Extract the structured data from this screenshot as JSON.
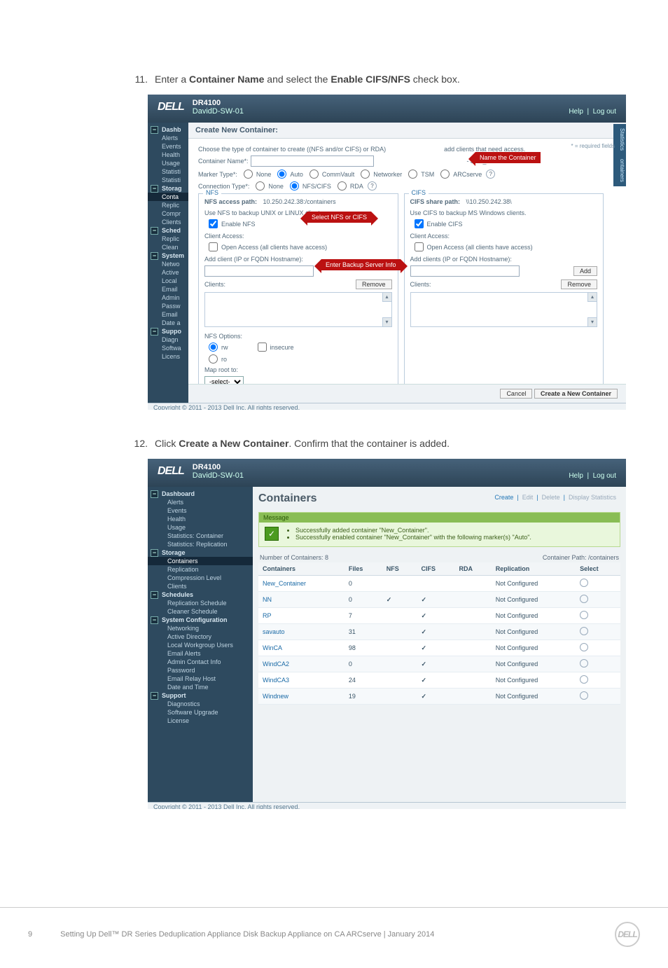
{
  "doc": {
    "step11_num": "11.",
    "step11_text_a": "Enter a ",
    "step11_b1": "Container Name",
    "step11_text_b": " and select the ",
    "step11_b2": "Enable CIFS/NFS",
    "step11_text_c": " check box.",
    "step12_num": "12.",
    "step12_text_a": "Click ",
    "step12_b1": "Create a New Container",
    "step12_text_b": ". Confirm that the container is added.",
    "page_num": "9",
    "footer_text": "Setting Up Dell™ DR Series Deduplication Appliance Disk Backup Appliance on CA ARCserve | January 2014",
    "dell": "DELL"
  },
  "hdr": {
    "product": "DR4100",
    "host": "DavidD-SW-01",
    "help": "Help",
    "logout": "Log out"
  },
  "sb1": {
    "dashb": "Dashb",
    "alerts": "Alerts",
    "events": "Events",
    "health": "Health",
    "usage": "Usage",
    "stat1": "Statisti",
    "stat2": "Statisti",
    "storag": "Storag",
    "conta": "Conta",
    "replic": "Replic",
    "compr": "Compr",
    "clients": "Clients",
    "sched": "Sched",
    "replic2": "Replic",
    "clean": "Clean",
    "system": "System",
    "netwo": "Netwo",
    "active": "Active",
    "local": "Local",
    "email": "Email",
    "admin": "Admin",
    "passw": "Passw",
    "emailr": "Email",
    "date": "Date a",
    "suppo": "Suppo",
    "diagn": "Diagn",
    "softw": "Softwa",
    "licens": "Licens"
  },
  "dlg": {
    "title": "Create New Container:",
    "choose": "Choose the type of container to create ((NFS and/or CIFS) or RDA)",
    "choose_tail": "add clients that need access.",
    "req_note": "* = required fields",
    "name_lbl": "Container Name*:",
    "name_hint": "- and _ characters.",
    "marker_lbl": "Marker Type*:",
    "m_none": "None",
    "m_auto": "Auto",
    "m_cv": "CommVault",
    "m_nw": "Networker",
    "m_tsm": "TSM",
    "m_arc": "ARCserve",
    "conn_lbl": "Connection Type*:",
    "c_none": "None",
    "c_nfs": "NFS/CIFS",
    "c_rda": "RDA",
    "nfs_legend": "NFS",
    "nfs_path_lbl": "NFS access path:",
    "nfs_path_val": "10.250.242.38:/containers",
    "nfs_desc": "Use NFS to backup UNIX or LINUX clients.",
    "nfs_enable": "Enable NFS",
    "nfs_ca": "Client Access:",
    "nfs_oa": "Open Access (all clients have access)",
    "nfs_add": "Add client (IP or FQDN Hostname):",
    "nfs_clients": "Clients:",
    "nfs_opts": "NFS Options:",
    "rw": "rw",
    "ro": "ro",
    "insecure": "insecure",
    "maproot": "Map root to:",
    "maproot_sel": "-select-",
    "cifs_legend": "CIFS",
    "cifs_path_lbl": "CIFS share path:",
    "cifs_path_val": "\\\\10.250.242.38\\",
    "cifs_desc": "Use CIFS to backup MS Windows clients.",
    "cifs_enable": "Enable CIFS",
    "cifs_ca": "Client Access:",
    "cifs_oa": "Open Access (all clients have access)",
    "cifs_add": "Add clients (IP or FQDN Hostname):",
    "cifs_clients": "Clients:",
    "add_btn": "Add",
    "remove_btn": "Remove",
    "cancel": "Cancel",
    "create": "Create a New Container",
    "rtab1": "Statistics",
    "rtab2": "ontainers",
    "callout_name": "Name the Container",
    "callout_sel": "Select NFS or CIFS",
    "callout_srv": "Enter Backup Server Info",
    "copyright": "Copyright © 2011 - 2013 Dell Inc. All rights reserved."
  },
  "sb2": {
    "items": [
      {
        "lbl": "Dashboard",
        "p": true
      },
      {
        "lbl": "Alerts"
      },
      {
        "lbl": "Events"
      },
      {
        "lbl": "Health"
      },
      {
        "lbl": "Usage"
      },
      {
        "lbl": "Statistics: Container"
      },
      {
        "lbl": "Statistics: Replication"
      },
      {
        "lbl": "Storage",
        "p": true
      },
      {
        "lbl": "Containers",
        "sel": true
      },
      {
        "lbl": "Replication"
      },
      {
        "lbl": "Compression Level"
      },
      {
        "lbl": "Clients"
      },
      {
        "lbl": "Schedules",
        "p": true
      },
      {
        "lbl": "Replication Schedule"
      },
      {
        "lbl": "Cleaner Schedule"
      },
      {
        "lbl": "System Configuration",
        "p": true
      },
      {
        "lbl": "Networking"
      },
      {
        "lbl": "Active Directory"
      },
      {
        "lbl": "Local Workgroup Users"
      },
      {
        "lbl": "Email Alerts"
      },
      {
        "lbl": "Admin Contact Info"
      },
      {
        "lbl": "Password"
      },
      {
        "lbl": "Email Relay Host"
      },
      {
        "lbl": "Date and Time"
      },
      {
        "lbl": "Support",
        "p": true
      },
      {
        "lbl": "Diagnostics"
      },
      {
        "lbl": "Software Upgrade"
      },
      {
        "lbl": "License"
      }
    ]
  },
  "pg2": {
    "title": "Containers",
    "a_create": "Create",
    "a_edit": "Edit",
    "a_delete": "Delete",
    "a_stats": "Display Statistics",
    "msg_head": "Message",
    "msg1": "Successfully added container \"New_Container\".",
    "msg2": "Successfully enabled container \"New_Container\" with the following marker(s) \"Auto\".",
    "count": "Number of Containers: 8",
    "path": "Container Path: /containers",
    "cols": {
      "c0": "Containers",
      "c1": "Files",
      "c2": "NFS",
      "c3": "CIFS",
      "c4": "RDA",
      "c5": "Replication",
      "c6": "Select"
    },
    "rows": [
      {
        "n": "New_Container",
        "f": "0",
        "nfs": "",
        "cifs": "",
        "rda": "",
        "rep": "Not Configured"
      },
      {
        "n": "NN",
        "f": "0",
        "nfs": "✓",
        "cifs": "✓",
        "rda": "",
        "rep": "Not Configured"
      },
      {
        "n": "RP",
        "f": "7",
        "nfs": "",
        "cifs": "✓",
        "rda": "",
        "rep": "Not Configured"
      },
      {
        "n": "savauto",
        "f": "31",
        "nfs": "",
        "cifs": "✓",
        "rda": "",
        "rep": "Not Configured"
      },
      {
        "n": "WinCA",
        "f": "98",
        "nfs": "",
        "cifs": "✓",
        "rda": "",
        "rep": "Not Configured"
      },
      {
        "n": "WindCA2",
        "f": "0",
        "nfs": "",
        "cifs": "✓",
        "rda": "",
        "rep": "Not Configured"
      },
      {
        "n": "WindCA3",
        "f": "24",
        "nfs": "",
        "cifs": "✓",
        "rda": "",
        "rep": "Not Configured"
      },
      {
        "n": "Windnew",
        "f": "19",
        "nfs": "",
        "cifs": "✓",
        "rda": "",
        "rep": "Not Configured"
      }
    ]
  }
}
